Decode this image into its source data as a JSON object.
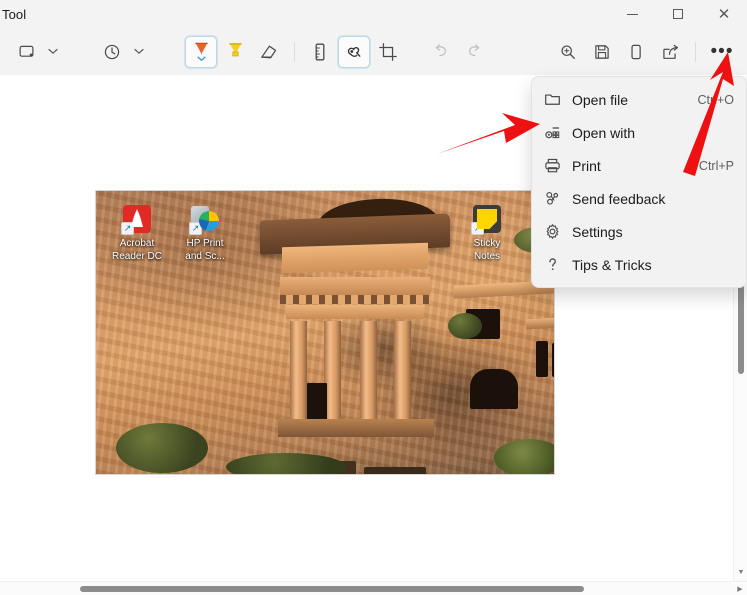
{
  "window": {
    "title": "Tool",
    "controls": {
      "minimize": "Minimize",
      "maximize": "Maximize",
      "close": "Close",
      "close_glyph": "✕"
    }
  },
  "toolbar": {
    "left": [
      {
        "name": "new-snip",
        "label": "New",
        "icon": "rectangle-snip-icon"
      },
      {
        "name": "new-snip-caret",
        "label": "Snip mode",
        "icon": "chevron-down-icon",
        "glyph": "⌄"
      },
      {
        "name": "delay",
        "label": "Delay",
        "icon": "clock-icon"
      },
      {
        "name": "delay-caret",
        "label": "Delay options",
        "icon": "chevron-down-icon",
        "glyph": "⌄"
      }
    ],
    "center": [
      {
        "name": "ballpoint-pen",
        "label": "Ballpoint pen",
        "icon": "pen-icon",
        "selected": true,
        "color": "#e8632a"
      },
      {
        "name": "highlighter",
        "label": "Highlighter",
        "icon": "highlighter-icon",
        "selected": false,
        "color": "#f5d020"
      },
      {
        "name": "eraser",
        "label": "Eraser",
        "icon": "eraser-icon",
        "selected": false
      },
      {
        "name": "ruler",
        "label": "Ruler",
        "icon": "ruler-icon",
        "selected": false
      },
      {
        "name": "touch-writing",
        "label": "Touch writing",
        "icon": "touch-writing-icon",
        "selected": true
      },
      {
        "name": "crop",
        "label": "Crop",
        "icon": "crop-icon",
        "selected": false
      },
      {
        "name": "undo",
        "label": "Undo",
        "icon": "undo-icon",
        "disabled": true
      },
      {
        "name": "redo",
        "label": "Redo",
        "icon": "redo-icon",
        "disabled": true
      }
    ],
    "right": [
      {
        "name": "zoom",
        "label": "Zoom",
        "icon": "magnifier-icon"
      },
      {
        "name": "save-as",
        "label": "Save as",
        "icon": "save-icon"
      },
      {
        "name": "copy",
        "label": "Copy",
        "icon": "copy-icon"
      },
      {
        "name": "share",
        "label": "Share",
        "icon": "share-icon"
      },
      {
        "name": "see-more",
        "label": "See more",
        "icon": "ellipsis-icon",
        "glyph": "•••"
      }
    ]
  },
  "menu": {
    "items": [
      {
        "label": "Open file",
        "shortcut": "Ctrl+O",
        "icon": "folder-icon"
      },
      {
        "label": "Open with",
        "shortcut": "",
        "icon": "open-with-icon"
      },
      {
        "label": "Print",
        "shortcut": "Ctrl+P",
        "icon": "printer-icon"
      },
      {
        "label": "Send feedback",
        "shortcut": "",
        "icon": "feedback-icon"
      },
      {
        "label": "Settings",
        "shortcut": "",
        "icon": "gear-icon"
      },
      {
        "label": "Tips & Tricks",
        "shortcut": "",
        "icon": "question-icon"
      }
    ]
  },
  "canvas": {
    "screenshot_alt": "Screenshot of a desktop wallpaper showing rock-cut tombs carved into an orange cliff face",
    "desktop_icons": [
      {
        "name": "acrobat-reader-dc",
        "line1": "Acrobat",
        "line2": "Reader DC",
        "shortcut_glyph": "↗"
      },
      {
        "name": "hp-print-and-scan",
        "line1": "HP Print",
        "line2": "and Sc...",
        "shortcut_glyph": "↗"
      },
      {
        "name": "sticky-notes",
        "line1": "Sticky",
        "line2": "Notes",
        "shortcut_glyph": "↗"
      }
    ]
  },
  "scrollbars": {
    "vertical": {
      "up_glyph": "▲",
      "down_glyph": "▼"
    },
    "horizontal": {
      "left_glyph": "◀",
      "right_glyph": "▶"
    }
  },
  "annotations": {
    "color": "#ee1111",
    "arrow_to_open_with": "Red arrow pointing right at the Open with menu item",
    "arrow_to_see_more": "Red arrow pointing up-right at the See more (...) toolbar button"
  }
}
